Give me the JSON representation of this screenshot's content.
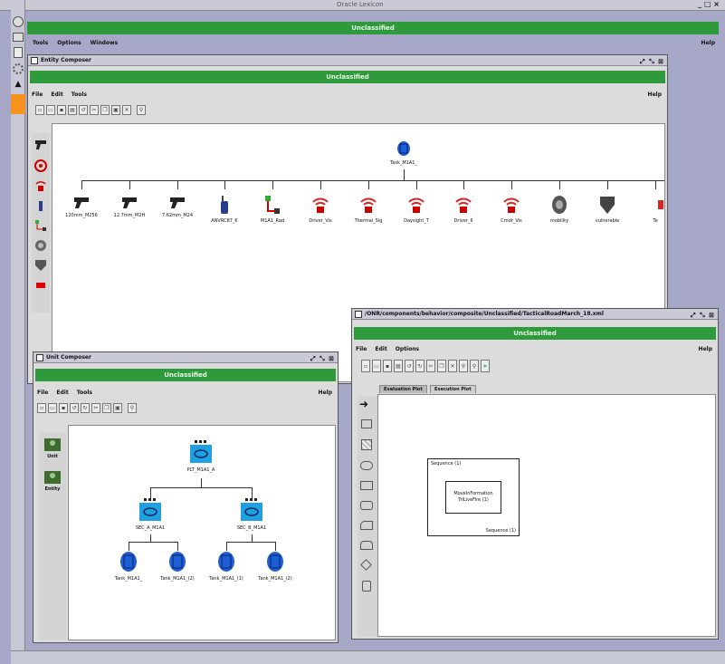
{
  "main_window": {
    "title": "Oracle Lexicon",
    "window_controls": "_ □ ×",
    "classification": "Unclassified",
    "menu": [
      "Tools",
      "Options",
      "Windows"
    ],
    "help": "Help",
    "left_strip_icons": [
      "user-icon",
      "folder-icon",
      "document-icon",
      "gear-icon",
      "arrow-icon"
    ]
  },
  "entity_composer": {
    "title": "Entity Composer",
    "window_controls": "⤢ ⤡ ⊠",
    "classification": "Unclassified",
    "menu": [
      "File",
      "Edit",
      "Tools"
    ],
    "help": "Help",
    "toolbar_icons": [
      "new-icon",
      "open-icon",
      "save-icon",
      "print-icon",
      "undo-icon",
      "cut-icon",
      "copy-icon",
      "paste-icon",
      "delete-icon",
      "zoom-icon"
    ],
    "palette_icons": [
      "pistol-icon",
      "target-icon",
      "radio-icon",
      "person-icon",
      "link-icon",
      "tire-icon",
      "shield-icon",
      "bar-icon"
    ],
    "root": {
      "label": "Task_M1A1_"
    },
    "children": [
      {
        "label": "120mm_M256",
        "icon": "gun"
      },
      {
        "label": "12.7mm_M2H",
        "icon": "gun"
      },
      {
        "label": "7.62mm_M24",
        "icon": "gun"
      },
      {
        "label": "ANVRC87_K",
        "icon": "radio"
      },
      {
        "label": "M1A1_Rad",
        "icon": "link"
      },
      {
        "label": "Driver_Vis",
        "icon": "sensor"
      },
      {
        "label": "Thermal_Sig",
        "icon": "sensor"
      },
      {
        "label": "Daysight_T",
        "icon": "sensor"
      },
      {
        "label": "Driver_II",
        "icon": "sensor"
      },
      {
        "label": "Cmdr_Vis",
        "icon": "sensor"
      },
      {
        "label": "mobility",
        "icon": "tire"
      },
      {
        "label": "vulnerable",
        "icon": "shield"
      },
      {
        "label": "Te",
        "icon": "partial"
      }
    ]
  },
  "unit_composer": {
    "title": "Unit Composer",
    "window_controls": "⤢ ⤡ ⊠",
    "classification": "Unclassified",
    "menu": [
      "File",
      "Edit",
      "Tools"
    ],
    "help": "Help",
    "palette": [
      {
        "label": "Unit"
      },
      {
        "label": "Entity"
      }
    ],
    "root": {
      "label": "PLT_M1A1_A"
    },
    "sections": [
      {
        "label": "SEC_A_M1A1",
        "tanks": [
          "Tank_M1A1_",
          "Tank_M1A1_(2)"
        ]
      },
      {
        "label": "SEC_B_M1A1",
        "tanks": [
          "Tank_M1A1_(1)",
          "Tank_M1A1_(2)"
        ]
      }
    ]
  },
  "behavior_composer": {
    "title": "/ONR/components/behavior/composite/Unclassified/TacticalRoadMarch_18.xml",
    "window_controls": "⤢ ⤡ ⊠",
    "classification": "Unclassified",
    "menu": [
      "File",
      "Edit",
      "Options"
    ],
    "help": "Help",
    "tabs": [
      "Evaluation Plot",
      "Execution Plot"
    ],
    "outer_box": {
      "title": "Sequence (1)",
      "footer": "Sequence (1)"
    },
    "inner_box": {
      "line1": "MoveInFormation",
      "line2": "TriLiveFire (1)"
    }
  }
}
